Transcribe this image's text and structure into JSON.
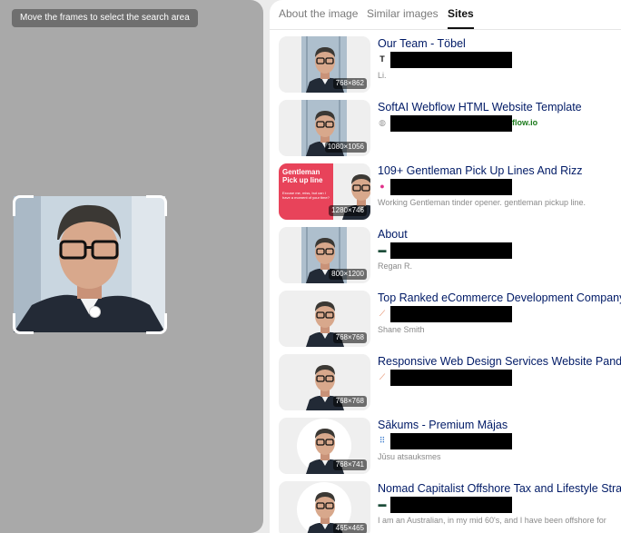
{
  "crop_panel": {
    "hint": "Move the frames to select the search area"
  },
  "tabs": [
    {
      "label": "About the image",
      "active": false
    },
    {
      "label": "Similar images",
      "active": false
    },
    {
      "label": "Sites",
      "active": true
    }
  ],
  "results": [
    {
      "title": "Our Team - Töbel",
      "icon": "T",
      "domain_suffix": "",
      "description": "Li.",
      "size": "768×862",
      "thumb_style": "office"
    },
    {
      "title": "SoftAI Webflow HTML Website Template",
      "icon": "globe-icon",
      "domain_suffix": "flow.io",
      "description": "",
      "size": "1080×1056",
      "thumb_style": "office"
    },
    {
      "title": "109+ Gentleman Pick Up Lines And Rizz",
      "icon": "chat-icon",
      "domain_suffix": "",
      "description": "Working Gentleman tinder opener. gentleman pickup line.",
      "size": "1280×746",
      "thumb_style": "promo",
      "promo_text": "Gentleman Pick up line",
      "promo_sub": "Excuse me, miss, but can I have a moment of your time?"
    },
    {
      "title": "About",
      "icon": "flag-icon",
      "domain_suffix": "",
      "description": "Regan R.",
      "size": "800×1200",
      "thumb_style": "office"
    },
    {
      "title": "Top Ranked eCommerce Development Company",
      "icon": "link-icon",
      "domain_suffix": "",
      "description": "Shane Smith",
      "size": "768×768",
      "thumb_style": "white"
    },
    {
      "title": "Responsive Web Design Services Website Panda",
      "icon": "link-icon",
      "domain_suffix": "",
      "description": "",
      "size": "768×768",
      "thumb_style": "white"
    },
    {
      "title": "Sākums - Premium Mājas",
      "icon": "grid-icon",
      "domain_suffix": "",
      "description": "Jūsu atsauksmes",
      "size": "768×741",
      "thumb_style": "circle"
    },
    {
      "title": "Nomad Capitalist Offshore Tax and Lifestyle Stra",
      "icon": "flag-icon",
      "domain_suffix": "",
      "description": "I am an Australian, in my mid 60's, and I have been offshore for",
      "size": "465×465",
      "thumb_style": "circle"
    }
  ],
  "colors": {
    "title": "#001a66",
    "crop_bg": "#a9a9a9",
    "promo_bg": "#e8435a"
  }
}
